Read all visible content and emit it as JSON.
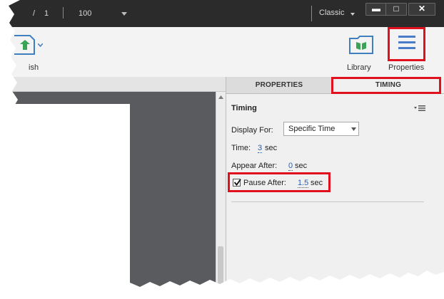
{
  "titlebar": {
    "page_sep": "/",
    "page_total": "1",
    "zoom": "100",
    "workspace": "Classic",
    "minimize": "▬",
    "restore": "□",
    "close": "✕"
  },
  "toolbar": {
    "publish_label": "ish",
    "library_label": "Library",
    "properties_label": "Properties"
  },
  "tabs": {
    "properties": "PROPERTIES",
    "timing": "TIMING"
  },
  "timing_panel": {
    "heading": "Timing",
    "display_for_label": "Display For:",
    "display_for_value": "Specific Time",
    "time_label": "Time:",
    "time_value": "3",
    "time_unit": "sec",
    "appear_after_label": "Appear After:",
    "appear_after_value": "0",
    "appear_after_unit": "sec",
    "pause_after_label": "Pause After:",
    "pause_after_value": "1.5",
    "pause_after_unit": "sec",
    "pause_after_checked": true
  },
  "colors": {
    "highlight": "#e0101e",
    "link_value": "#2a5db0",
    "library_icon": "#3f7fc0",
    "properties_icon": "#4a7cc9",
    "publish_icon": "#3aa356"
  }
}
